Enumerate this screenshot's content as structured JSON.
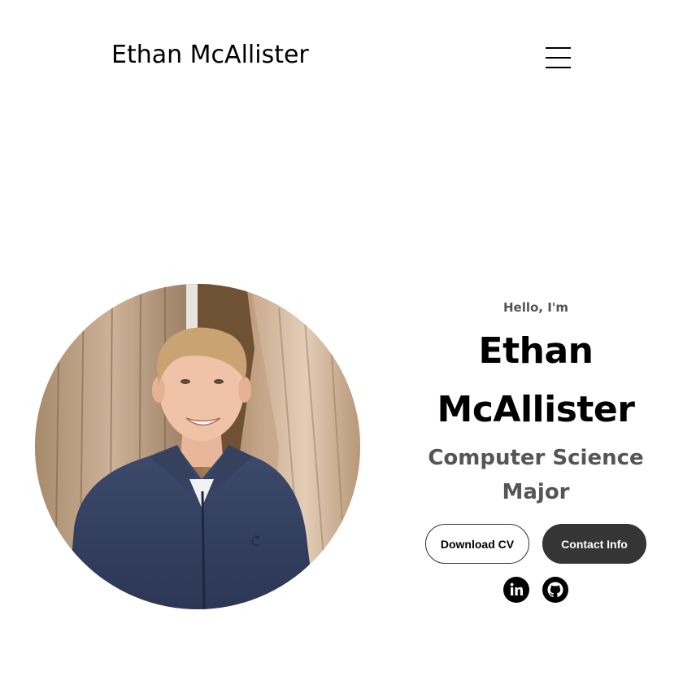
{
  "nav": {
    "logo": "Ethan McAllister",
    "menu_icon": "hamburger-menu-icon"
  },
  "profile": {
    "image_alt": "Ethan McAllister profile picture"
  },
  "hero": {
    "greeting": "Hello, I'm",
    "name": "Ethan McAllister",
    "title": "Computer Science Major",
    "download_cv_label": "Download CV",
    "contact_label": "Contact Info"
  },
  "socials": [
    {
      "name": "linkedin",
      "icon": "linkedin-icon"
    },
    {
      "name": "github",
      "icon": "github-icon"
    }
  ],
  "colors": {
    "text_primary": "#000000",
    "text_secondary": "#555555",
    "button_dark": "#353535",
    "background": "#ffffff"
  }
}
